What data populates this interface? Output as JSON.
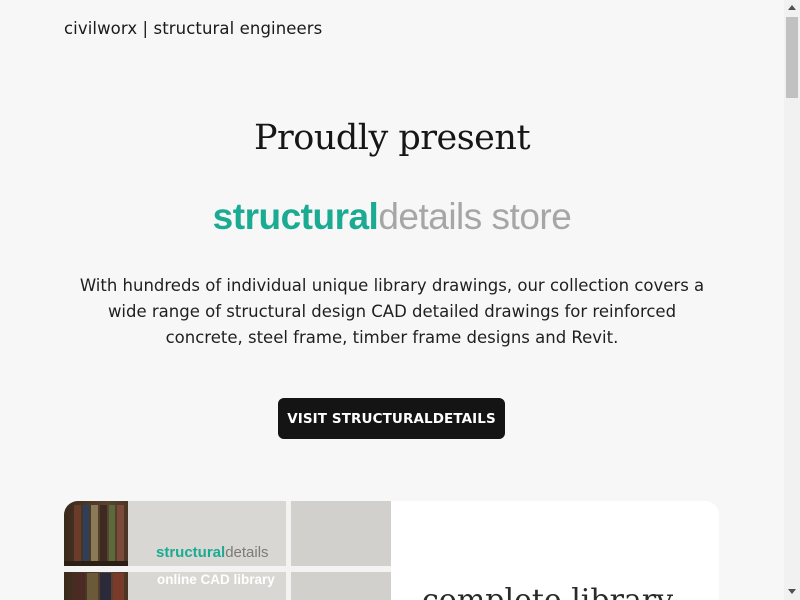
{
  "header": {
    "site_title": "civilworx | structural engineers"
  },
  "hero": {
    "heading": "Proudly present",
    "logo_part1": "structural",
    "logo_part2": "details store",
    "description": "With hundreds of individual unique library drawings, our collection covers a wide range of structural design CAD detailed drawings for reinforced concrete, steel frame, timber frame designs and Revit.",
    "cta_label": "VISIT STRUCTURALDETAILS"
  },
  "feature": {
    "photo_logo_part1": "structural",
    "photo_logo_part2": "details",
    "photo_subtitle": "online CAD library",
    "title": "complete library"
  },
  "colors": {
    "accent": "#1aab92",
    "logo_grey": "#a6a6a6",
    "button_bg": "#141414",
    "page_bg": "#f7f7f7"
  },
  "icons": {
    "scroll_up": "chevron-up-icon",
    "scroll_down": "chevron-down-icon"
  }
}
